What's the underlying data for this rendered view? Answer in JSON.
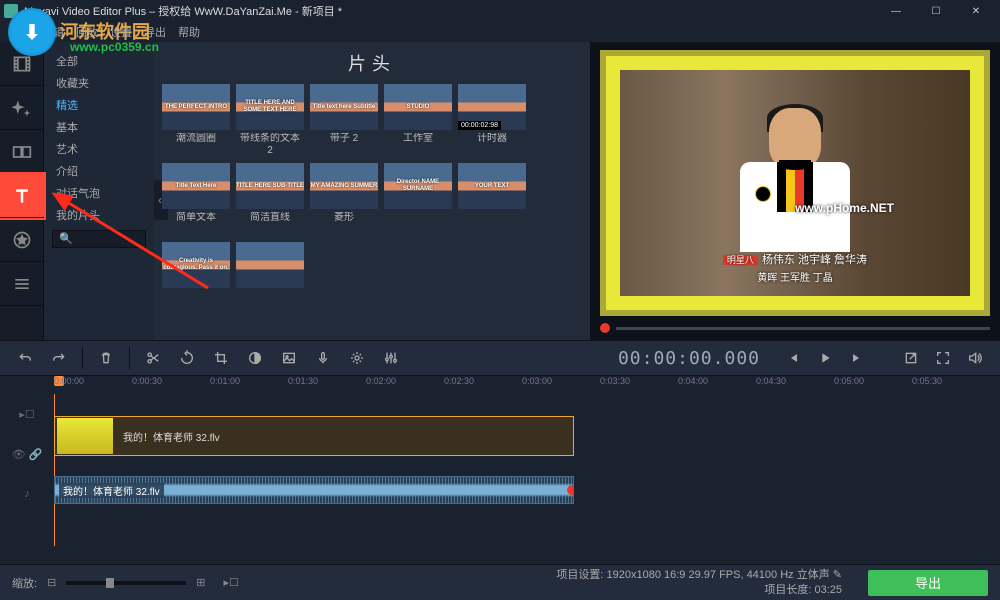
{
  "window": {
    "title": "Movavi Video Editor Plus – 授权给 WwW.DaYanZai.Me - 新项目 *"
  },
  "menu": [
    "文件",
    "编辑",
    "回放",
    "设置",
    "导出",
    "帮助"
  ],
  "watermark": {
    "brand": "河东软件园",
    "url": "www.pc0359.cn"
  },
  "sidebar_categories": {
    "title": "片头",
    "items": [
      "全部",
      "收藏夹",
      "精选",
      "基本",
      "艺术",
      "介绍",
      "对话气泡",
      "我的片头"
    ],
    "selected_index": 2
  },
  "presets": [
    {
      "name": "潮流圆圈",
      "overlay": "THE PERFECT INTRO"
    },
    {
      "name": "带线条的文本 2",
      "overlay": "TITLE HERE\nAND SOME TEXT HERE"
    },
    {
      "name": "带子 2",
      "overlay": "Title text here\nSubtitle"
    },
    {
      "name": "工作室",
      "overlay": "STUDIO"
    },
    {
      "name": "计时器",
      "overlay": "",
      "badge": "00:00:02:98"
    },
    {
      "name": "简单文本",
      "overlay": "Title Text Here"
    },
    {
      "name": "简洁直线",
      "overlay": "TITLE HERE\nSUB-TITLE"
    },
    {
      "name": "菱形",
      "overlay": "MY AMAZING SUMMER"
    },
    {
      "name": "",
      "overlay": "Director\nNAME SURNAME"
    },
    {
      "name": "",
      "overlay": "YOUR TEXT"
    },
    {
      "name": "",
      "overlay": "Creativity is contagious.\nPass it on."
    },
    {
      "name": "",
      "overlay": ""
    }
  ],
  "search_placeholder": "🔍",
  "preview": {
    "caption_tag": "明星八",
    "caption_line1": "杨伟东 池宇峰 詹华涛",
    "caption_line2": "黄晖 王军胜 丁晶",
    "watermark": "www.pHome.NET"
  },
  "timecode": "00:00:00.000",
  "ruler_ticks": [
    "0:00:00",
    "0:00:30",
    "0:01:00",
    "0:01:30",
    "0:02:00",
    "0:02:30",
    "0:03:00",
    "0:03:30",
    "0:04:00",
    "0:04:30",
    "0:05:00",
    "0:05:30"
  ],
  "clips": {
    "video_label": "我的！体育老师 32.flv",
    "audio_label": "我的！体育老师 32.flv"
  },
  "status": {
    "zoom_label": "缩放:",
    "project_settings": "项目设置: 1920x1080 16:9 29.97 FPS, 44100 Hz 立体声",
    "project_length": "项目长度: 03:25",
    "export": "导出"
  }
}
